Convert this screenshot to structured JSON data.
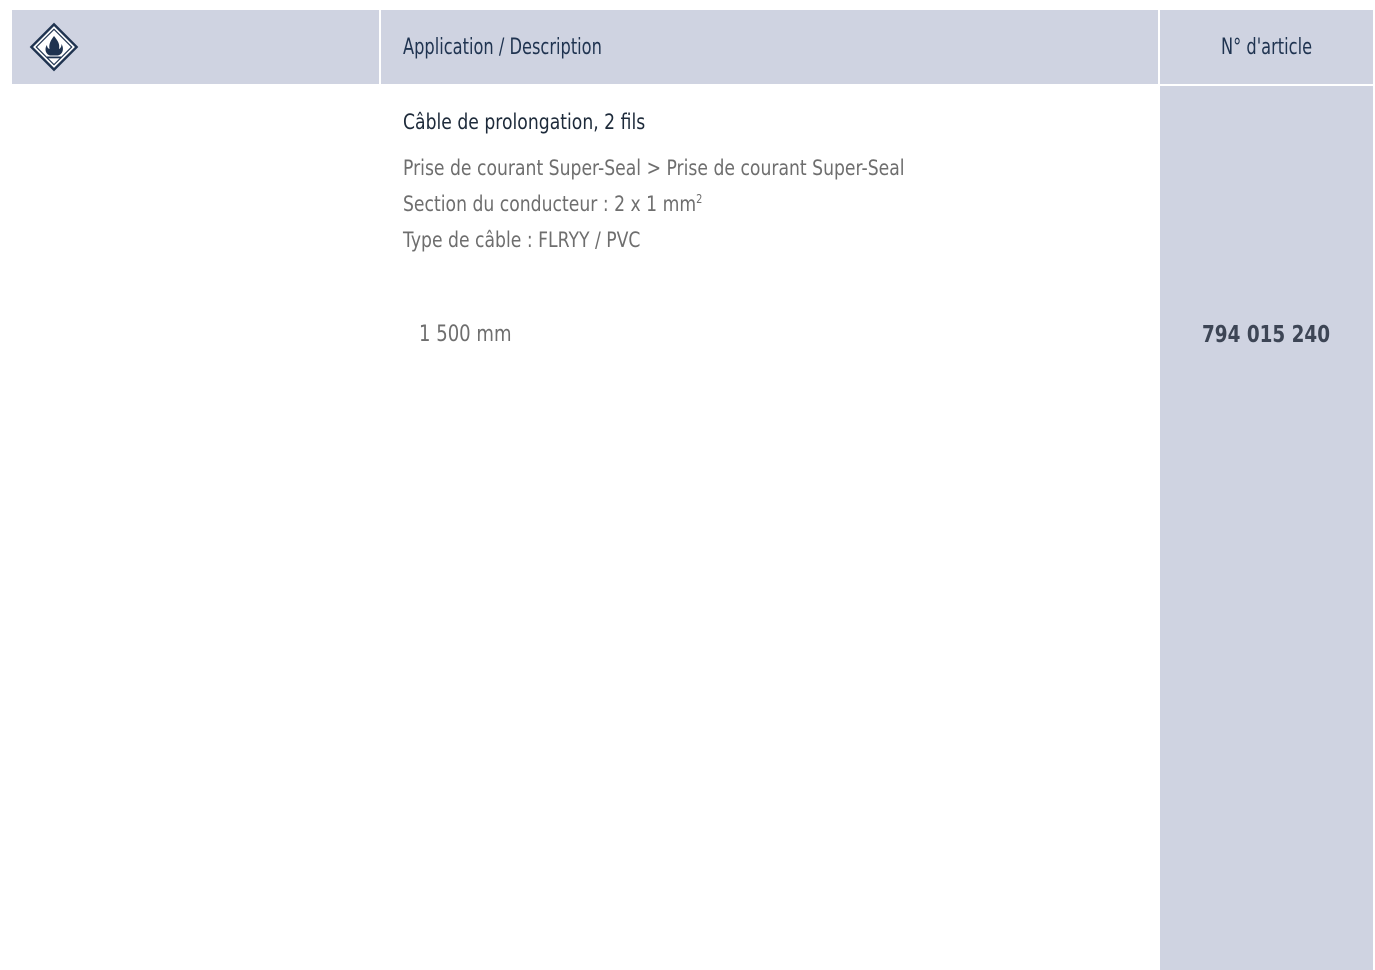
{
  "header": {
    "icon": "flammable-hazard-icon",
    "description_label": "Application / Description",
    "article_label": "N° d'article"
  },
  "product": {
    "title": "Câble de prolongation, 2 fils",
    "line1": "Prise de courant Super-Seal > Prise de courant Super-Seal",
    "line2_prefix": "Section du conducteur : 2 x 1 mm",
    "line2_sup": "2",
    "line3": "Type de câble : FLRYY / PVC"
  },
  "rows": [
    {
      "length": "1 500 mm",
      "article_number": "794 015 240"
    }
  ],
  "colors": {
    "header_bg": "#cfd3e1",
    "header_text": "#1f3350",
    "body_text": "#6e6e6e"
  }
}
